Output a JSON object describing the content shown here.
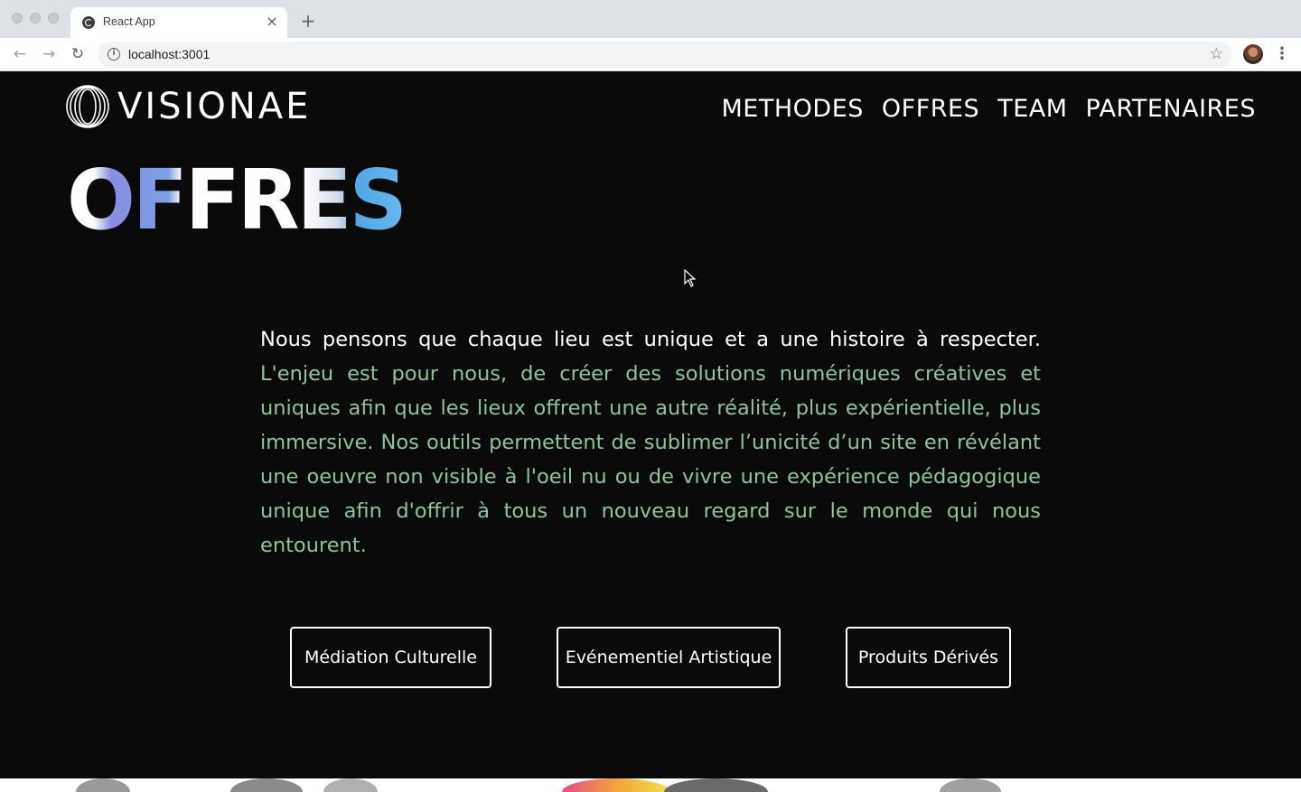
{
  "browser": {
    "tab_title": "React App",
    "tab_close": "×",
    "new_tab": "+",
    "url": "localhost:3001",
    "back": "←",
    "forward": "→",
    "reload": "↻",
    "info": "i",
    "star": "☆",
    "menu": "⋮"
  },
  "site": {
    "logo_text": "VISIONAE",
    "nav": [
      "METHODES",
      "OFFRES",
      "TEAM",
      "PARTENAIRES"
    ],
    "hero_title": "OFFRES",
    "intro_lead": "Nous pensons que chaque lieu est unique et a une histoire à respecter.",
    "intro_body": "L'enjeu est pour nous, de créer des solutions numériques créatives et uniques afin que les lieux offrent une autre réalité, plus expérientielle, plus immersive. Nos outils permettent de sublimer l’unicité d’un site en révélant une oeuvre non visible à l'oeil nu ou de vivre une expérience pédagogique unique afin d'offrir à tous un nouveau regard sur le monde qui nous entourent.",
    "offers": [
      "Médiation Culturelle",
      "Evénementiel Artistique",
      "Produits Dérivés"
    ]
  },
  "colors": {
    "page_bg": "#0a0a0a",
    "body_text_green": "#8ec39a",
    "text_white": "#ffffff",
    "hero_gradient_start": "#8a8de0",
    "hero_gradient_end": "#4fa8e8"
  }
}
